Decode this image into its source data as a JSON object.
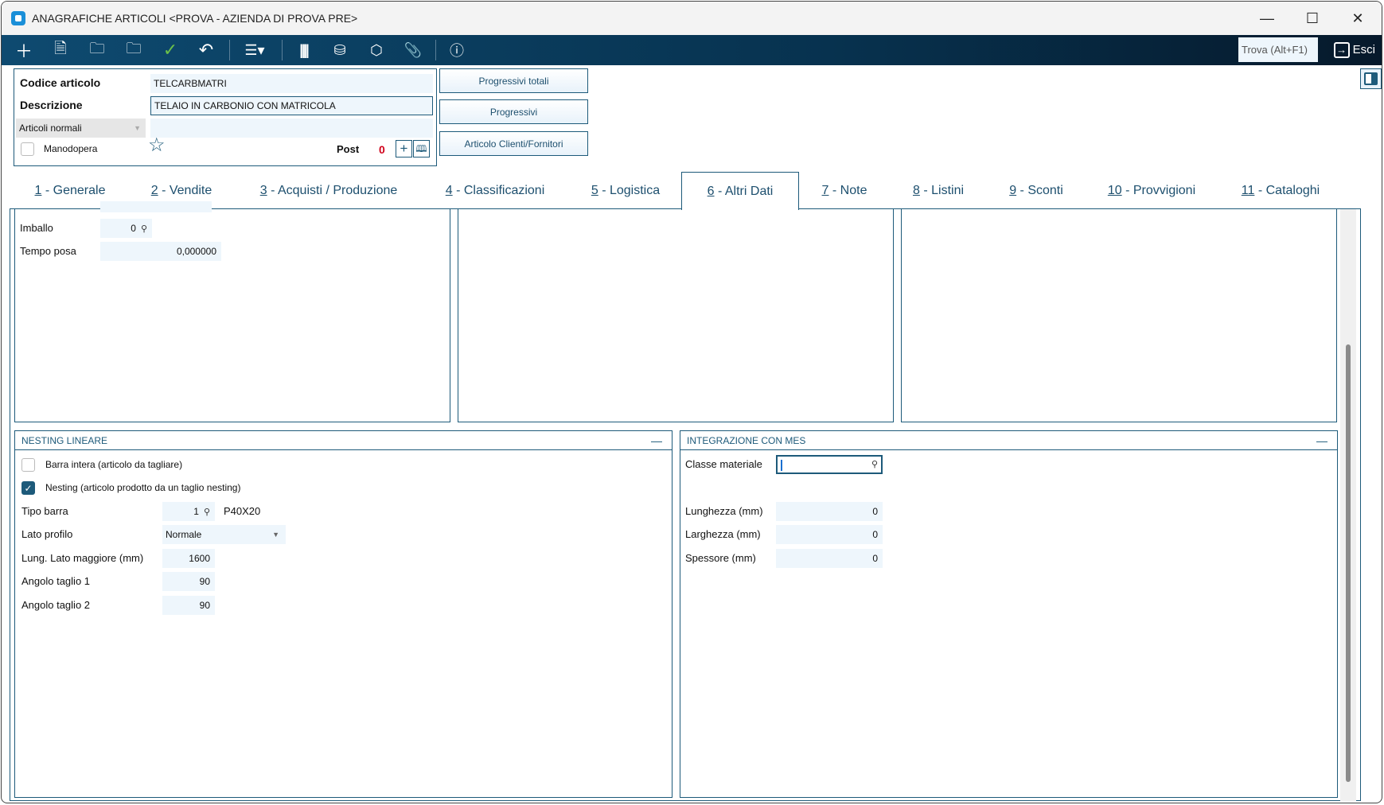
{
  "window": {
    "title": "ANAGRAFICHE ARTICOLI <PROVA - AZIENDA DI PROVA PRE>",
    "minimize": "—",
    "maximize": "☐",
    "close": "✕"
  },
  "toolbar": {
    "icons": [
      "plus-icon",
      "document-icon",
      "folder-open-icon",
      "folder-clock-icon",
      "check-icon",
      "undo-icon",
      "menu-icon",
      "barcode-icon",
      "basket-icon",
      "package-icon",
      "paperclip-icon",
      "help-icon"
    ],
    "find_label": "Trova (Alt+F1)",
    "exit_label": "Esci"
  },
  "header": {
    "code_label": "Codice articolo",
    "code_value": "TELCARBMATRI",
    "desc_label": "Descrizione",
    "desc_value": "TELAIO IN CARBONIO CON MATRICOLA",
    "type_value": "Articoli normali",
    "manodopera_label": "Manodopera",
    "manodopera_checked": false,
    "post_label": "Post",
    "post_count": "0"
  },
  "buttons": {
    "progressivi_totali": "Progressivi totali",
    "progressivi": "Progressivi",
    "clienti_fornitori": "Articolo Clienti/Fornitori"
  },
  "tabs": [
    {
      "n": "1",
      "label": " - Generale"
    },
    {
      "n": "2",
      "label": " - Vendite"
    },
    {
      "n": "3",
      "label": " - Acquisti / Produzione"
    },
    {
      "n": "4",
      "label": " - Classificazioni"
    },
    {
      "n": "5",
      "label": " - Logistica"
    },
    {
      "n": "6",
      "label": " - Altri Dati",
      "active": true
    },
    {
      "n": "7",
      "label": " - Note"
    },
    {
      "n": "8",
      "label": " - Listini"
    },
    {
      "n": "9",
      "label": " - Sconti"
    },
    {
      "n": "10",
      "label": " - Provvigioni"
    },
    {
      "n": "11",
      "label": " - Cataloghi"
    }
  ],
  "other": {
    "imballo_label": "Imballo",
    "imballo_value": "0",
    "tempo_label": "Tempo posa",
    "tempo_value": "0,000000"
  },
  "nesting": {
    "title": "NESTING LINEARE",
    "barra_label": "Barra intera (articolo da tagliare)",
    "barra_checked": false,
    "nesting_label": "Nesting (articolo prodotto da un taglio nesting)",
    "nesting_checked": true,
    "tipo_label": "Tipo barra",
    "tipo_value": "1",
    "tipo_desc": "P40X20",
    "lato_label": "Lato profilo",
    "lato_value": "Normale",
    "lung_label": "Lung. Lato maggiore (mm)",
    "lung_value": "1600",
    "ang1_label": "Angolo taglio 1",
    "ang1_value": "90",
    "ang2_label": "Angolo taglio 2",
    "ang2_value": "90"
  },
  "mes": {
    "title": "INTEGRAZIONE CON MES",
    "classe_label": "Classe materiale",
    "classe_value": "",
    "lung_label": "Lunghezza (mm)",
    "lung_value": "0",
    "larg_label": "Larghezza (mm)",
    "larg_value": "0",
    "spess_label": "Spessore (mm)",
    "spess_value": "0"
  }
}
